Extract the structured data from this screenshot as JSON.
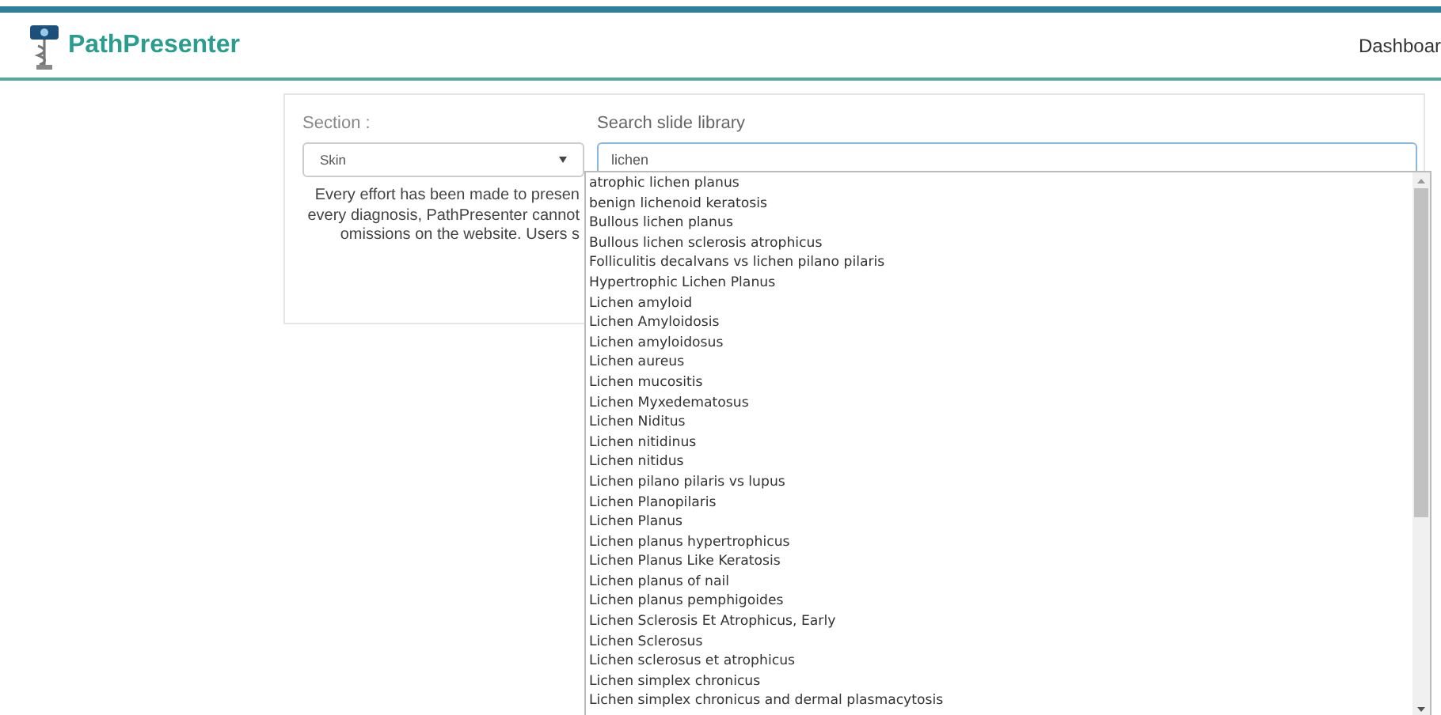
{
  "header": {
    "brand": "PathPresenter",
    "nav_link": "Dashboar"
  },
  "section": {
    "label": "Section :",
    "value": "Skin"
  },
  "search": {
    "label": "Search slide library",
    "value": "lichen"
  },
  "notice_lines": [
    "Every effort has been made to presen",
    "every diagnosis, PathPresenter cannot",
    "omissions on the website. Users s"
  ],
  "suggestions": [
    "atrophic lichen planus",
    "benign lichenoid keratosis",
    "Bullous lichen planus",
    "Bullous lichen sclerosis atrophicus",
    "Folliculitis decalvans vs lichen pilano pilaris",
    "Hypertrophic Lichen Planus",
    "Lichen amyloid",
    "Lichen Amyloidosis",
    "Lichen amyloidosus",
    "Lichen aureus",
    "Lichen mucositis",
    "Lichen Myxedematosus",
    "Lichen Niditus",
    "Lichen nitidinus",
    "Lichen nitidus",
    "Lichen pilano pilaris vs lupus",
    "Lichen Planopilaris",
    "Lichen Planus",
    "Lichen planus hypertrophicus",
    "Lichen Planus Like Keratosis",
    "Lichen planus of nail",
    "Lichen planus pemphigoides",
    "Lichen Sclerosis Et Atrophicus, Early",
    "Lichen Sclerosus",
    "Lichen sclerosus et atrophicus",
    "Lichen simplex chronicus",
    "Lichen simplex chronicus and dermal plasmacytosis"
  ]
}
